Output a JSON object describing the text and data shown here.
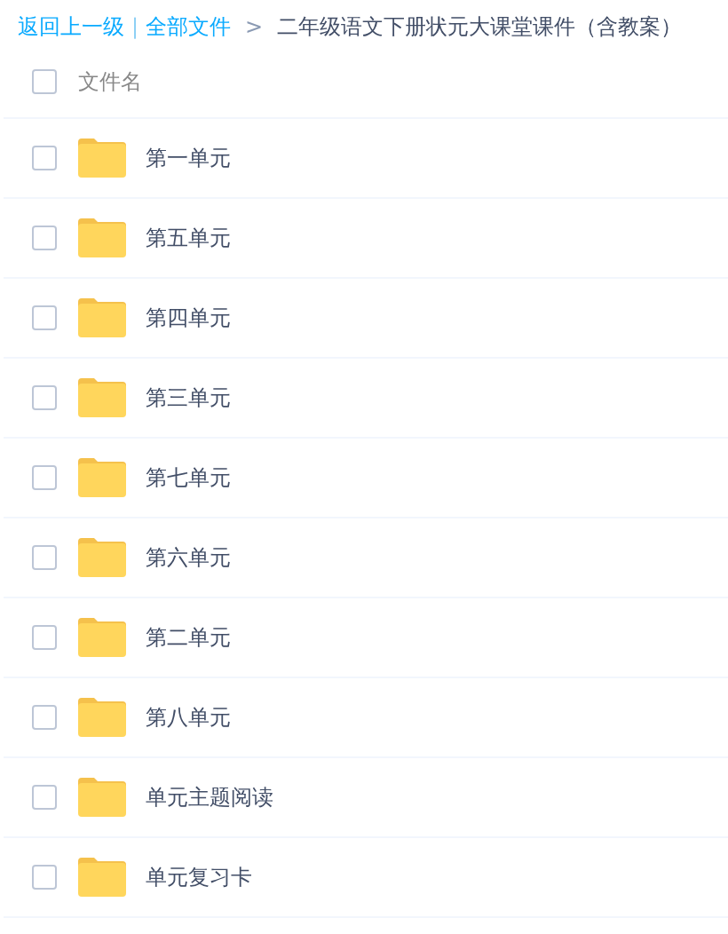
{
  "breadcrumb": {
    "back": "返回上一级",
    "separator": "|",
    "root": "全部文件",
    "arrow": ">",
    "current": "二年级语文下册状元大课堂课件（含教案）"
  },
  "header": {
    "checked": false,
    "label": "文件名"
  },
  "files": [
    {
      "name": "第一单元",
      "checked": false
    },
    {
      "name": "第五单元",
      "checked": false
    },
    {
      "name": "第四单元",
      "checked": false
    },
    {
      "name": "第三单元",
      "checked": false
    },
    {
      "name": "第七单元",
      "checked": false
    },
    {
      "name": "第六单元",
      "checked": false
    },
    {
      "name": "第二单元",
      "checked": false
    },
    {
      "name": "第八单元",
      "checked": false
    },
    {
      "name": "单元主题阅读",
      "checked": false
    },
    {
      "name": "单元复习卡",
      "checked": false
    }
  ]
}
